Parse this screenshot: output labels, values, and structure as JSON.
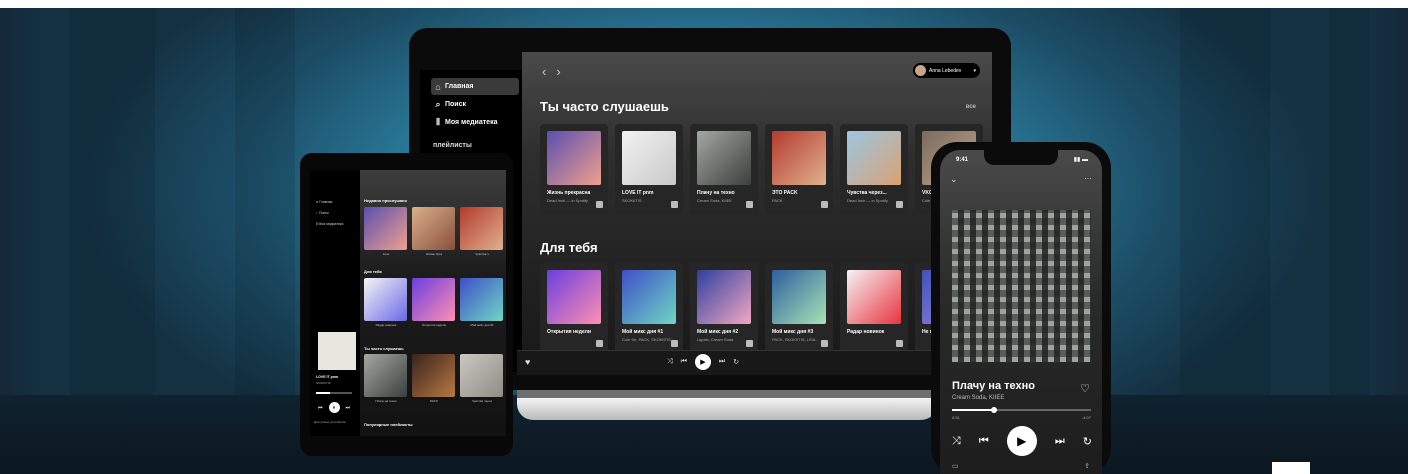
{
  "laptop": {
    "sidebar": {
      "items": [
        {
          "label": "Главная",
          "icon": "home-icon"
        },
        {
          "label": "Поиск",
          "icon": "search-icon"
        },
        {
          "label": "Моя медиатека",
          "icon": "library-icon"
        }
      ],
      "section": "плейлисты"
    },
    "user": {
      "name": "Anna Lebedev"
    },
    "section1": {
      "title": "Ты часто слушаешь",
      "all": "все",
      "cards": [
        {
          "title": "Жизнь прекрасна",
          "subtitle": "Dead Inch — in Spotify",
          "color_a": "#5a4fb0",
          "color_b": "#f0a08c"
        },
        {
          "title": "LOVE IT pnm",
          "subtitle": "SKOKIITIS",
          "color_a": "#f2f2f2",
          "color_b": "#c9c9c9"
        },
        {
          "title": "Плачу на техно",
          "subtitle": "Cream Soda, KIIEE",
          "color_a": "#a4a7a3",
          "color_b": "#3b3f3d"
        },
        {
          "title": "ЭТО PACK",
          "subtitle": "PACK",
          "color_a": "#b43a2d",
          "color_b": "#e0b18e"
        },
        {
          "title": "Чувства через...",
          "subtitle": "Dead Inch — in Spotify",
          "color_a": "#9cc6e3",
          "color_b": "#d9a273"
        },
        {
          "title": "VKO",
          "subtitle": "Cole Se",
          "color_a": "#7a6b5e",
          "color_b": "#c1a58a"
        }
      ]
    },
    "section2": {
      "title": "Для тебя",
      "cards": [
        {
          "title": "Открытия недели",
          "subtitle": "",
          "color_a": "#6a3fe0",
          "color_b": "#ff8fb1"
        },
        {
          "title": "Мой микс дня #1",
          "subtitle": "Cole Se, PACK, SKOKIITIS",
          "color_a": "#3f4fc9",
          "color_b": "#6ed6c4"
        },
        {
          "title": "Мой микс дня #2",
          "subtitle": "Ligoist, Cream Soda",
          "color_a": "#2e3f9f",
          "color_b": "#f2a8c1"
        },
        {
          "title": "Мой микс дня #3",
          "subtitle": "PACK, SKOKIITIS, LISA...",
          "color_a": "#2c5fa0",
          "color_b": "#a8e3b4"
        },
        {
          "title": "Радар новинок",
          "subtitle": "",
          "color_a": "#f4f4f4",
          "color_b": "#e8343f"
        },
        {
          "title": "Не пр",
          "subtitle": "",
          "color_a": "#4250b8",
          "color_b": "#9a8be0"
        }
      ]
    }
  },
  "tablet": {
    "nav": [
      "Главная",
      "Поиск",
      "Моя медиатека"
    ],
    "section1": "Недавно прослушано",
    "row1": [
      {
        "caption": "Love",
        "color_a": "#5a4fb0",
        "color_b": "#f0a08c"
      },
      {
        "caption": "Жизнь прек",
        "color_a": "#d9b08a",
        "color_b": "#8a4e3c"
      },
      {
        "caption": "Чувства ч",
        "color_a": "#b43a2d",
        "color_b": "#e0b18e"
      }
    ],
    "section2": "Для тебя",
    "row2": [
      {
        "caption": "Радар новинок",
        "color_a": "#f4f4f4",
        "color_b": "#6a6ae8"
      },
      {
        "caption": "Открытия недели",
        "color_a": "#6a3fe0",
        "color_b": "#ff8fb1"
      },
      {
        "caption": "Мой микс дня #1",
        "color_a": "#3f4fc9",
        "color_b": "#6ed6c4"
      }
    ],
    "section3": "Ты часто слушаешь",
    "row3": [
      {
        "caption": "Плачу на техно",
        "color_a": "#a4a7a3",
        "color_b": "#3b3f3d"
      },
      {
        "caption": "PACK",
        "color_a": "#3a241c",
        "color_b": "#b87843"
      },
      {
        "caption": "Чувства через",
        "color_a": "#c9c9c1",
        "color_b": "#8d8d84"
      }
    ],
    "now_playing": {
      "title": "LOVE IT pnm",
      "artist": "SKOKIITIS"
    },
    "devices": "Доступные устройства",
    "popular": "Популярные плейлисты"
  },
  "phone": {
    "time": "9:41",
    "track": {
      "title": "Плачу на техно",
      "artist": "Cream Soda, KIIEE"
    },
    "elapsed": "0:51",
    "remaining": "-4:07",
    "progress_pct": 30
  },
  "colors": {
    "accent": "#1DB954",
    "bg": "#121212"
  }
}
